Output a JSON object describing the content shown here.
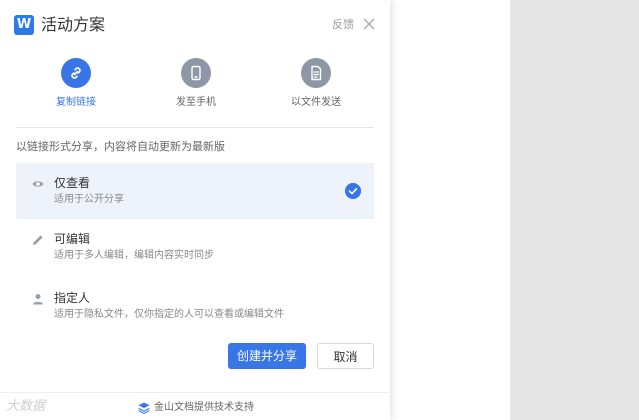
{
  "header": {
    "logo_letter": "W",
    "title": "活动方案",
    "feedback": "反馈"
  },
  "methods": [
    {
      "label": "复制链接",
      "icon": "link-icon",
      "active": true
    },
    {
      "label": "发至手机",
      "icon": "phone-icon",
      "active": false
    },
    {
      "label": "以文件发送",
      "icon": "file-icon",
      "active": false
    }
  ],
  "hint": "以链接形式分享，内容将自动更新为最新版",
  "options": [
    {
      "title": "仅查看",
      "desc": "适用于公开分享",
      "icon": "eye-icon",
      "selected": true
    },
    {
      "title": "可编辑",
      "desc": "适用于多人编辑，编辑内容实时同步",
      "icon": "pencil-icon",
      "selected": false
    },
    {
      "title": "指定人",
      "desc": "适用于隐私文件，仅你指定的人可以查看或编辑文件",
      "icon": "person-icon",
      "selected": false
    }
  ],
  "buttons": {
    "create": "创建并分享",
    "cancel": "取消"
  },
  "footer": {
    "text": "金山文档提供技术支持",
    "icon": "kingsoft-docs-icon"
  },
  "watermark": "大数据"
}
